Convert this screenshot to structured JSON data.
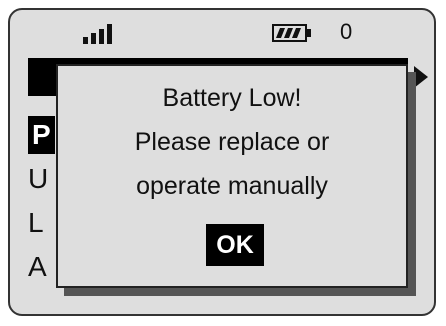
{
  "status_bar": {
    "signal_icon": "signal-bars-icon",
    "battery_icon": "battery-low-icon",
    "count": "0"
  },
  "menu": {
    "arrow_icon": "triangle-right-icon",
    "items": [
      {
        "label": "P"
      },
      {
        "label": "U"
      },
      {
        "label": "L"
      },
      {
        "label": "A"
      }
    ]
  },
  "dialog": {
    "line1": "Battery Low!",
    "line2": "Please replace or",
    "line3": "operate manually",
    "ok_label": "OK"
  },
  "colors": {
    "screen_bg": "#dedede",
    "highlight": "#000000",
    "shadow": "#555555"
  }
}
